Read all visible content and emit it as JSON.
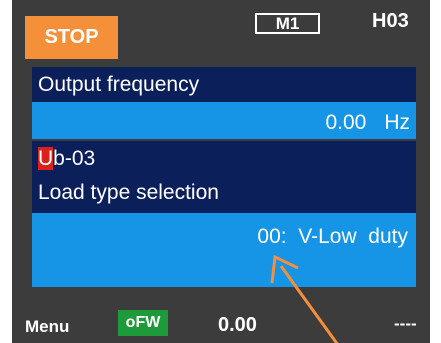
{
  "header": {
    "state": "STOP",
    "mode": "M1",
    "code": "H03"
  },
  "monitor": {
    "title": "Output frequency",
    "value": "0.00",
    "unit": "Hz"
  },
  "parameter": {
    "code_first_char": "U",
    "code_rest": "b-03",
    "name": "Load type selection",
    "setting": "00:  V-Low  duty"
  },
  "status_bar": {
    "menu": "Menu",
    "direction": "oFW",
    "frequency": "0.00",
    "extra": "----"
  },
  "colors": {
    "screen_bg": "#3c3c3c",
    "stop_badge": "#f5903a",
    "navy_row": "#0b1f5a",
    "blue_row": "#1694e6",
    "highlight_red": "#d9221e",
    "direction_green": "#1e9a3b",
    "arrow": "#f5903a"
  }
}
